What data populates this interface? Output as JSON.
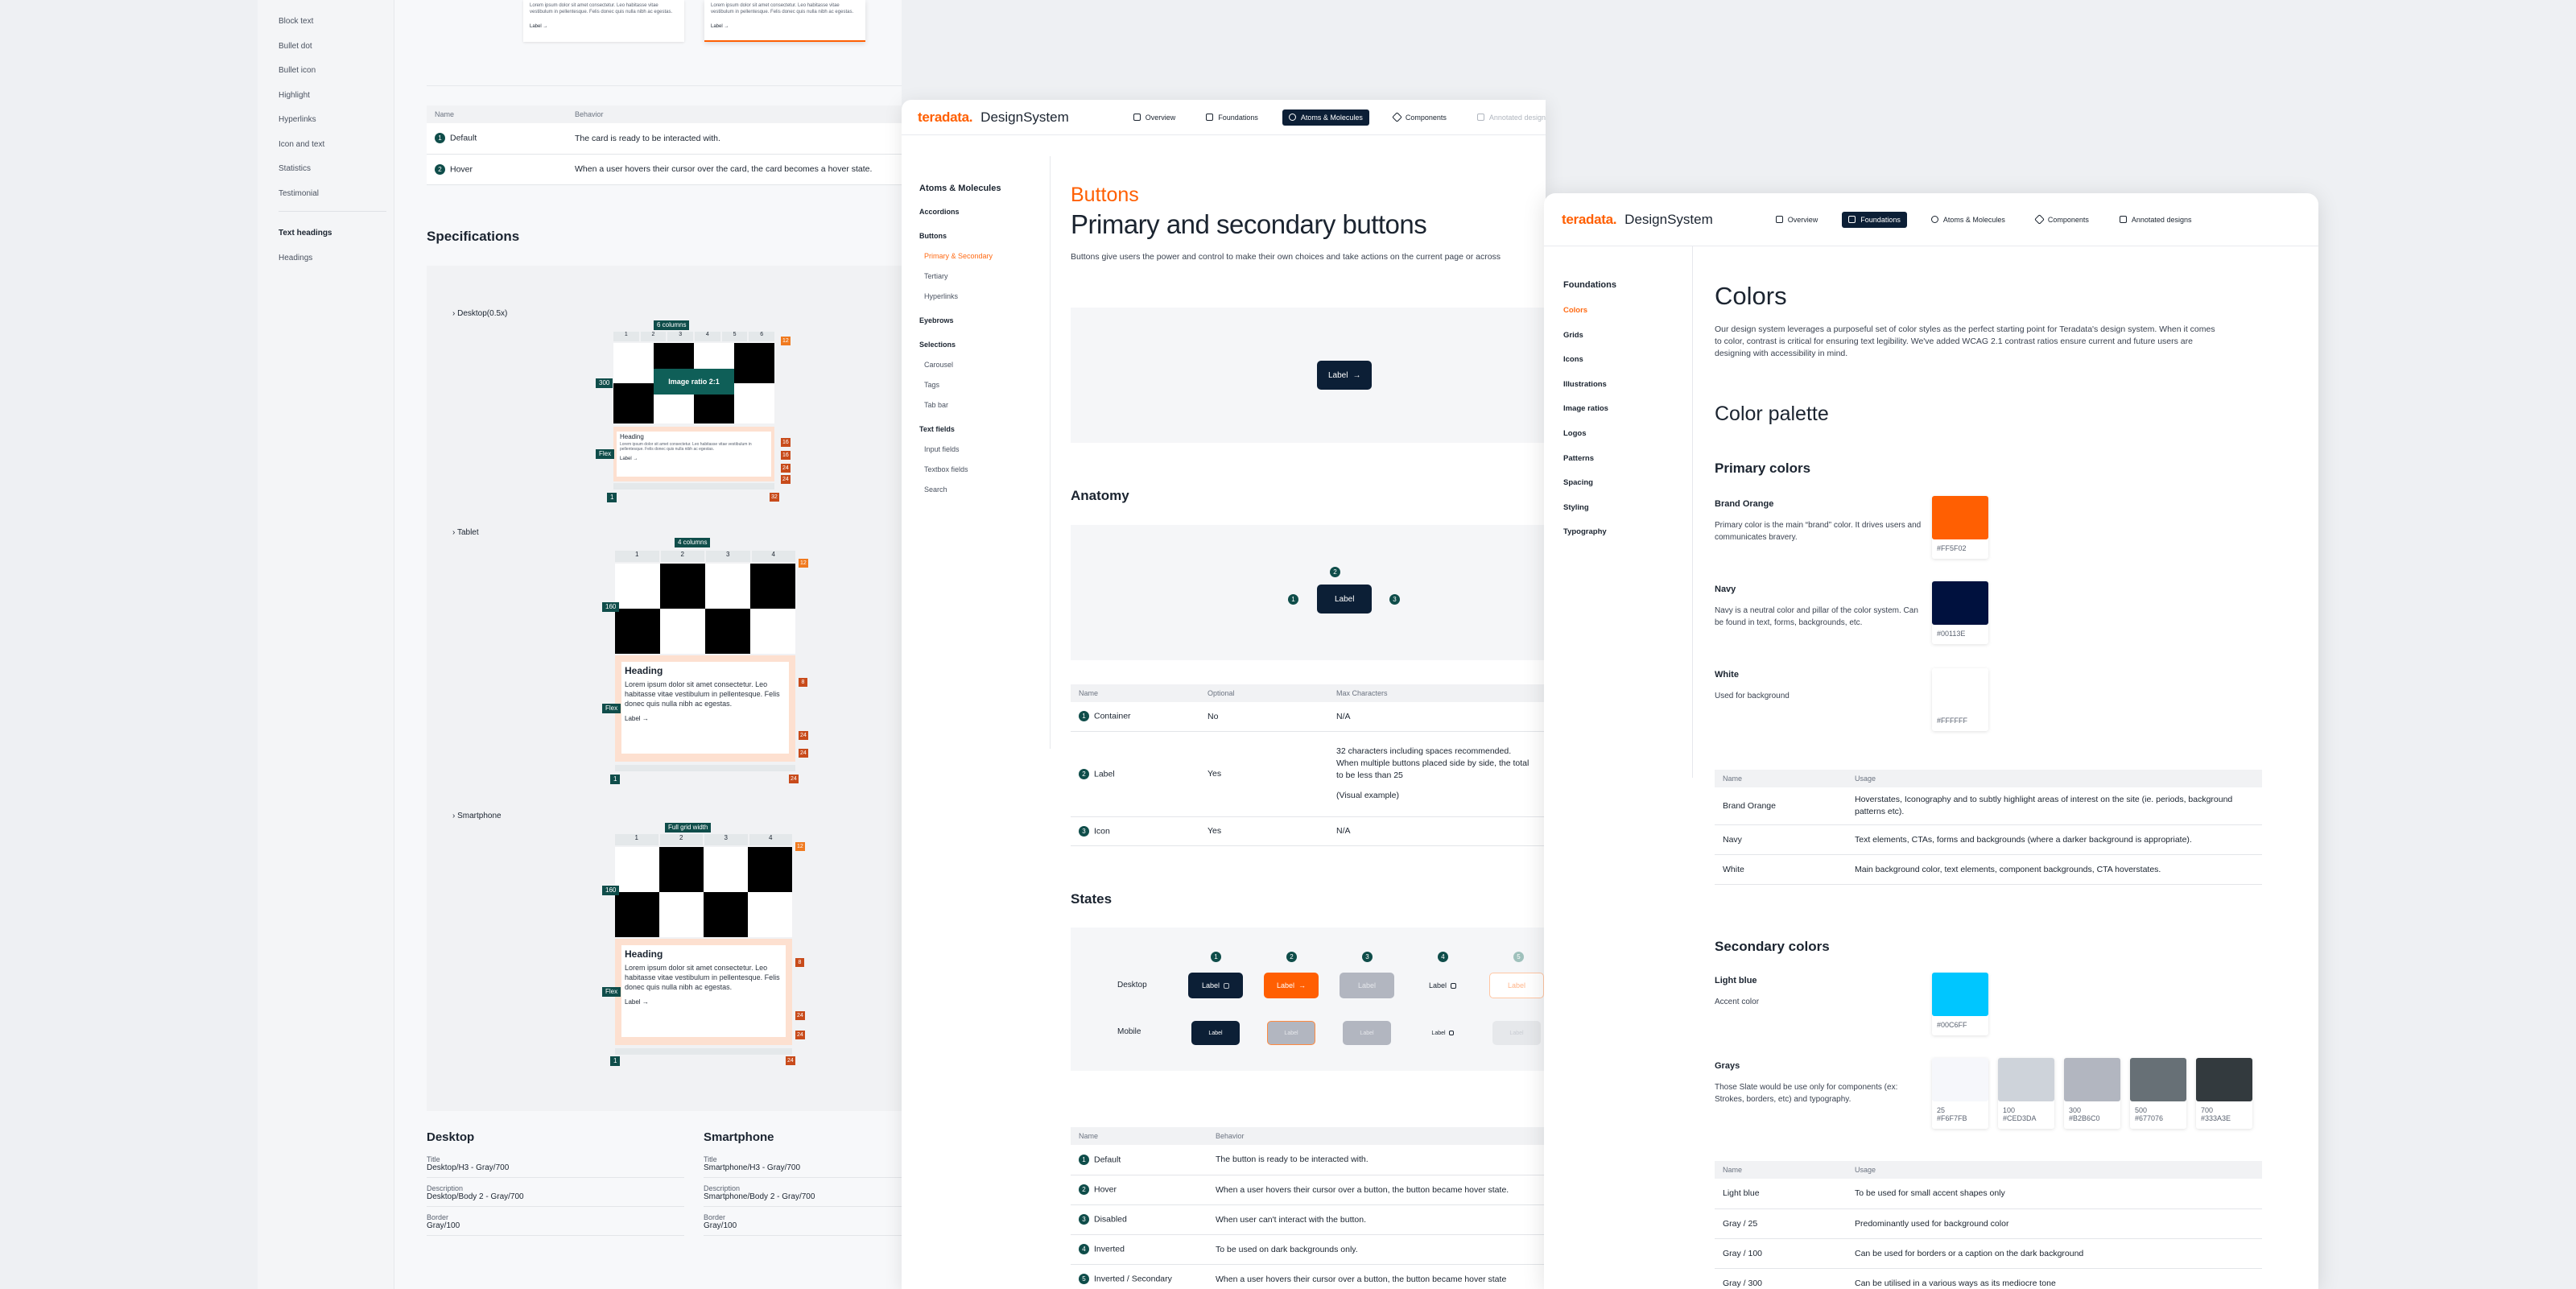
{
  "left_sidebar": {
    "items": [
      "Block text",
      "Bullet dot",
      "Bullet icon",
      "Highlight",
      "Hyperlinks",
      "Icon and text",
      "Statistics",
      "Testimonial"
    ],
    "section2_title": "Text headings",
    "section2_items": [
      "Headings"
    ]
  },
  "left_panel": {
    "card_text": "Lorem ipsum dolor sit amet consectetur. Leo habitasse vitae vestibulum in pellentesque. Felis donec quis nulla nibh ac egestas.",
    "card_link": "Label",
    "behavior_table": {
      "headers": [
        "Name",
        "Behavior"
      ],
      "rows": [
        {
          "n": "1",
          "name": "Default",
          "behavior": "The card is ready to be interacted with."
        },
        {
          "n": "2",
          "name": "Hover",
          "behavior": "When a user hovers their cursor over the card, the card becomes a hover state."
        }
      ]
    },
    "spec_title": "Specifications",
    "sections": [
      {
        "label": "Desktop(0.5x)",
        "columns_tag": "6 columns",
        "cols": [
          "1",
          "2",
          "3",
          "4",
          "5",
          "6"
        ],
        "ratio": "Image ratio 2:1",
        "heading": "Heading",
        "left_tag": "300",
        "flex_tag": "Flex",
        "bottom_left": "1",
        "bottom_right": "32",
        "right_tags": [
          "16",
          "16",
          "24",
          "24"
        ],
        "corner": "12"
      },
      {
        "label": "Tablet",
        "columns_tag": "4 columns",
        "cols": [
          "1",
          "2",
          "3",
          "4"
        ],
        "heading": "Heading",
        "text": "Lorem ipsum dolor sit amet consectetur. Leo habitasse vitae vestibulum in pellentesque. Felis donec quis nulla nibh ac egestas.",
        "link": "Label",
        "left_tag": "160",
        "flex_tag": "Flex",
        "bottom_left": "1",
        "bottom_right": "24",
        "right_tags": [
          "8",
          "24",
          "24"
        ],
        "corner": "12"
      },
      {
        "label": "Smartphone",
        "columns_tag": "Full grid width",
        "cols": [
          "1",
          "2",
          "3",
          "4"
        ],
        "heading": "Heading",
        "text": "Lorem ipsum dolor sit amet consectetur. Leo habitasse vitae vestibulum in pellentesque. Felis donec quis nulla nibh ac egestas.",
        "link": "Label",
        "left_tag": "160",
        "flex_tag": "Flex",
        "bottom_left": "1",
        "bottom_right": "24",
        "right_tags": [
          "8",
          "24",
          "24"
        ],
        "corner": "12"
      }
    ],
    "specs_desktop": {
      "title": "Desktop",
      "rows": [
        {
          "k": "Title",
          "v": "Desktop/H3 - Gray/700"
        },
        {
          "k": "Description",
          "v": "Desktop/Body 2 - Gray/700"
        },
        {
          "k": "Border",
          "v": "Gray/100"
        }
      ]
    },
    "specs_smartphone": {
      "title": "Smartphone",
      "rows": [
        {
          "k": "Title",
          "v": "Smartphone/H3 - Gray/700"
        },
        {
          "k": "Description",
          "v": "Smartphone/Body 2 - Gray/700"
        },
        {
          "k": "Border",
          "v": "Gray/100"
        }
      ]
    }
  },
  "buttons_page": {
    "brand": "teradata.",
    "brand2": "DesignSystem",
    "nav": [
      {
        "label": "Overview",
        "icon": "home-icon"
      },
      {
        "label": "Foundations",
        "icon": "grid-icon"
      },
      {
        "label": "Atoms & Molecules",
        "icon": "atom-icon",
        "active": true
      },
      {
        "label": "Components",
        "icon": "component-icon"
      },
      {
        "label": "Annotated designs",
        "icon": "annotation-icon"
      }
    ],
    "sidebar": [
      {
        "label": "Atoms & Molecules",
        "type": "title"
      },
      {
        "label": "Accordions",
        "type": "head"
      },
      {
        "label": "Buttons",
        "type": "head"
      },
      {
        "label": "Primary & Secondary",
        "type": "active"
      },
      {
        "label": "Tertiary",
        "type": "sub"
      },
      {
        "label": "Hyperlinks",
        "type": "sub"
      },
      {
        "label": "Eyebrows",
        "type": "head"
      },
      {
        "label": "Selections",
        "type": "head"
      },
      {
        "label": "Carousel",
        "type": "sub"
      },
      {
        "label": "Tags",
        "type": "sub"
      },
      {
        "label": "Tab bar",
        "type": "sub"
      },
      {
        "label": "Text fields",
        "type": "head"
      },
      {
        "label": "Input fields",
        "type": "sub"
      },
      {
        "label": "Textbox fields",
        "type": "sub"
      },
      {
        "label": "Search",
        "type": "sub"
      }
    ],
    "eyebrow": "Buttons",
    "title": "Primary and secondary buttons",
    "intro": "Buttons give users the power and control to make their own choices and take actions on the current page or across",
    "demo_label": "Label",
    "anatomy_title": "Anatomy",
    "anatomy_label": "Label",
    "anatomy_markers": [
      "1",
      "2",
      "3"
    ],
    "anatomy_table": {
      "headers": [
        "Name",
        "Optional",
        "Max Characters"
      ],
      "rows": [
        {
          "n": "1",
          "name": "Container",
          "optional": "No",
          "max": "N/A"
        },
        {
          "n": "2",
          "name": "Label",
          "optional": "Yes",
          "max": "32 characters including spaces recommended.",
          "max2": "When multiple buttons placed side by side, the total",
          "max3": "to be less than 25",
          "max4": "(Visual example)"
        },
        {
          "n": "3",
          "name": "Icon",
          "optional": "Yes",
          "max": "N/A"
        }
      ]
    },
    "states_title": "States",
    "states_cols": [
      "1",
      "2",
      "3",
      "4",
      "5"
    ],
    "states_rows": [
      "Desktop",
      "Mobile"
    ],
    "state_label": "Label",
    "states_table": {
      "headers": [
        "Name",
        "Behavior"
      ],
      "rows": [
        {
          "n": "1",
          "name": "Default",
          "behavior": "The button is ready to be interacted with."
        },
        {
          "n": "2",
          "name": "Hover",
          "behavior": "When a user hovers their cursor over a button, the button became hover state."
        },
        {
          "n": "3",
          "name": "Disabled",
          "behavior": "When user can't interact with the button."
        },
        {
          "n": "4",
          "name": "Inverted",
          "behavior": "To be used on dark backgrounds only."
        },
        {
          "n": "5",
          "name": "Inverted / Secondary",
          "behavior": "When a user hovers their cursor over a button, the button became hover state"
        }
      ]
    }
  },
  "colors_page": {
    "brand": "teradata.",
    "brand2": "DesignSystem",
    "nav": [
      {
        "label": "Overview",
        "icon": "home-icon"
      },
      {
        "label": "Foundations",
        "icon": "grid-icon",
        "active": true
      },
      {
        "label": "Atoms & Molecules",
        "icon": "atom-icon"
      },
      {
        "label": "Components",
        "icon": "component-icon"
      },
      {
        "label": "Annotated designs",
        "icon": "annotation-icon"
      }
    ],
    "sidebar_title": "Foundations",
    "sidebar": [
      "Colors",
      "Grids",
      "Icons",
      "Illustrations",
      "Image ratios",
      "Logos",
      "Patterns",
      "Spacing",
      "Styling",
      "Typography"
    ],
    "title": "Colors",
    "intro": "Our design system leverages a purposeful set of color styles as the perfect starting point for Teradata's design system. When it comes to color, contrast is critical for ensuring text legibility. We've added WCAG 2.1 contrast ratios ensure current and future users are designing with accessibility in mind.",
    "palette_title": "Color palette",
    "primary_title": "Primary colors",
    "primary": [
      {
        "name": "Brand Orange",
        "desc": "Primary color is the main “brand” color. It drives users and communicates bravery.",
        "hex": "#FF5F02",
        "color": "#ff5f02"
      },
      {
        "name": "Navy",
        "desc": "Navy is a neutral color and pillar of the color system. Can be found in text, forms, backgrounds, etc.",
        "hex": "#00113E",
        "color": "#00113e"
      },
      {
        "name": "White",
        "desc": "Used for background",
        "hex": "#FFFFFF",
        "color": "#ffffff"
      }
    ],
    "primary_table": {
      "headers": [
        "Name",
        "Usage"
      ],
      "rows": [
        {
          "name": "Brand Orange",
          "usage": "Hoverstates, Iconography and to subtly highlight areas of interest on the site (ie. periods, background patterns etc)."
        },
        {
          "name": "Navy",
          "usage": "Text elements, CTAs, forms and backgrounds (where a darker background is appropriate)."
        },
        {
          "name": "White",
          "usage": "Main background color, text elements, component backgrounds, CTA hoverstates."
        }
      ]
    },
    "secondary_title": "Secondary colors",
    "light_blue": {
      "name": "Light blue",
      "desc": "Accent color",
      "hex": "#00C6FF",
      "color": "#00c6ff"
    },
    "grays": {
      "name": "Grays",
      "desc": "Those Slate would be use only for components (ex: Strokes, borders, etc) and typography.",
      "swatches": [
        {
          "label": "25",
          "hex": "#F6F7FB",
          "color": "#f6f7fb"
        },
        {
          "label": "100",
          "hex": "#CED3DA",
          "color": "#ced3da"
        },
        {
          "label": "300",
          "hex": "#B2B6C0",
          "color": "#b2b6c0"
        },
        {
          "label": "500",
          "hex": "#677076",
          "color": "#677076"
        },
        {
          "label": "700",
          "hex": "#333A3E",
          "color": "#333a3e"
        }
      ]
    },
    "secondary_table": {
      "headers": [
        "Name",
        "Usage"
      ],
      "rows": [
        {
          "name": "Light blue",
          "usage": "To be used for small accent shapes only"
        },
        {
          "name": "Gray / 25",
          "usage": "Predominantly used for background color"
        },
        {
          "name": "Gray / 100",
          "usage": "Can be used for borders or a caption on the dark background"
        },
        {
          "name": "Gray / 300",
          "usage": "Can be utilised in a various ways as its mediocre tone"
        }
      ]
    }
  }
}
